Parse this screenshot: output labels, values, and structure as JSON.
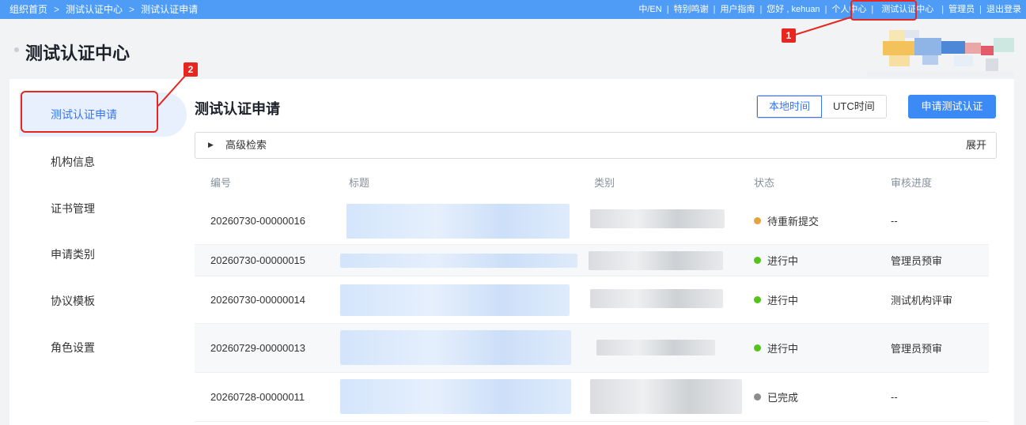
{
  "breadcrumb": [
    "组织首页",
    "测试认证中心",
    "测试认证申请"
  ],
  "breadcrumb_sep": ">",
  "top_nav": {
    "lang": "中/EN",
    "thanks": "特别鸣谢",
    "guide": "用户指南",
    "greeting": "您好 , kehuan",
    "personal": "个人中心",
    "test_center": "测试认证中心",
    "admin": "管理员",
    "logout": "退出登录",
    "sep": "|"
  },
  "page_title": "测试认证中心",
  "sidebar": {
    "items": [
      {
        "label": "测试认证申请",
        "active": true
      },
      {
        "label": "机构信息"
      },
      {
        "label": "证书管理"
      },
      {
        "label": "申请类别"
      },
      {
        "label": "协议模板"
      },
      {
        "label": "角色设置"
      }
    ]
  },
  "main": {
    "title": "测试认证申请",
    "time_local": "本地时间",
    "time_utc": "UTC时间",
    "apply_button": "申请测试认证",
    "search_label": "高级检索",
    "search_expand": "展开"
  },
  "table": {
    "headers": [
      "编号",
      "标题",
      "类别",
      "状态",
      "审核进度"
    ],
    "rows": [
      {
        "id": "20260730-00000016",
        "status": "待重新提交",
        "status_color": "#e6a23c",
        "progress": "--"
      },
      {
        "id": "20260730-00000015",
        "status": "进行中",
        "status_color": "#52c41a",
        "progress": "管理员预审"
      },
      {
        "id": "20260730-00000014",
        "status": "进行中",
        "status_color": "#52c41a",
        "progress": "测试机构评审"
      },
      {
        "id": "20260729-00000013",
        "status": "进行中",
        "status_color": "#52c41a",
        "progress": "管理员预审"
      },
      {
        "id": "20260728-00000011",
        "status": "已完成",
        "status_color": "#8c8c8c",
        "progress": "--"
      }
    ]
  },
  "annotations": [
    "1",
    "2"
  ],
  "colors": {
    "accent": "#3875f6",
    "topbar": "#4e9cf5",
    "annotation": "#e6261f"
  }
}
